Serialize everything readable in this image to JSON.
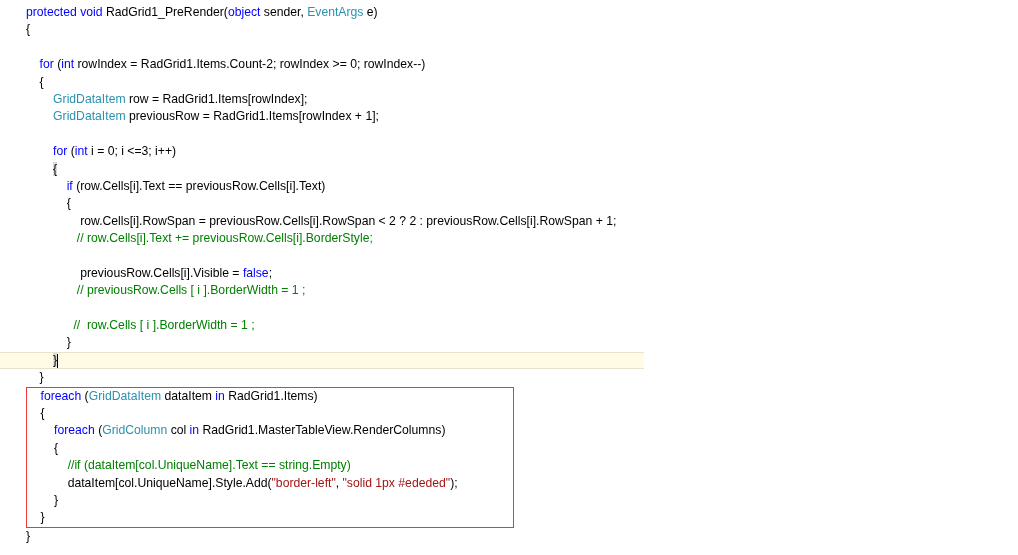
{
  "editor": {
    "sections": [
      {
        "boxed": false,
        "lines": [
          {
            "kind": "code",
            "current": false,
            "tokens": [
              {
                "kind": "keyword",
                "text": "protected void "
              },
              {
                "kind": "plain",
                "text": "RadGrid1_PreRender("
              },
              {
                "kind": "keyword",
                "text": "object"
              },
              {
                "kind": "plain",
                "text": " sender, "
              },
              {
                "kind": "type",
                "text": "EventArgs"
              },
              {
                "kind": "plain",
                "text": " e)"
              }
            ]
          },
          {
            "kind": "code",
            "current": false,
            "tokens": [
              {
                "kind": "plain",
                "text": "{"
              }
            ]
          },
          {
            "kind": "blank",
            "current": false
          },
          {
            "kind": "code",
            "current": false,
            "tokens": [
              {
                "kind": "keyword",
                "text": "    for"
              },
              {
                "kind": "plain",
                "text": " ("
              },
              {
                "kind": "keyword",
                "text": "int"
              },
              {
                "kind": "plain",
                "text": " rowIndex = RadGrid1.Items.Count-2; rowIndex >= 0; rowIndex--)"
              }
            ]
          },
          {
            "kind": "code",
            "current": false,
            "tokens": [
              {
                "kind": "plain",
                "text": "    {"
              }
            ]
          },
          {
            "kind": "code",
            "current": false,
            "tokens": [
              {
                "kind": "type",
                "text": "        GridDataItem"
              },
              {
                "kind": "plain",
                "text": " row = RadGrid1.Items[rowIndex];"
              }
            ]
          },
          {
            "kind": "code",
            "current": false,
            "tokens": [
              {
                "kind": "type",
                "text": "        GridDataItem"
              },
              {
                "kind": "plain",
                "text": " previousRow = RadGrid1.Items[rowIndex + 1];"
              }
            ]
          },
          {
            "kind": "blank",
            "current": false
          },
          {
            "kind": "code",
            "current": false,
            "tokens": [
              {
                "kind": "keyword",
                "text": "        for"
              },
              {
                "kind": "plain",
                "text": " ("
              },
              {
                "kind": "keyword",
                "text": "int"
              },
              {
                "kind": "plain",
                "text": " i = 0; i <=3; i++)"
              }
            ]
          },
          {
            "kind": "code",
            "current": false,
            "tokens": [
              {
                "kind": "plain",
                "text": "        {",
                "match": true
              }
            ]
          },
          {
            "kind": "code",
            "current": false,
            "tokens": [
              {
                "kind": "keyword",
                "text": "            if"
              },
              {
                "kind": "plain",
                "text": " (row.Cells[i].Text == previousRow.Cells[i].Text)"
              }
            ]
          },
          {
            "kind": "code",
            "current": false,
            "tokens": [
              {
                "kind": "plain",
                "text": "            {"
              }
            ]
          },
          {
            "kind": "code",
            "current": false,
            "tokens": [
              {
                "kind": "plain",
                "text": "                row.Cells[i].RowSpan = previousRow.Cells[i].RowSpan < 2 ? 2 : previousRow.Cells[i].RowSpan + 1;"
              }
            ]
          },
          {
            "kind": "code",
            "current": false,
            "tokens": [
              {
                "kind": "comment",
                "text": "               // row.Cells[i].Text += previousRow.Cells[i].BorderStyle;"
              }
            ]
          },
          {
            "kind": "blank",
            "current": false
          },
          {
            "kind": "code",
            "current": false,
            "tokens": [
              {
                "kind": "plain",
                "text": "                previousRow.Cells[i].Visible = "
              },
              {
                "kind": "keyword",
                "text": "false"
              },
              {
                "kind": "plain",
                "text": ";"
              }
            ]
          },
          {
            "kind": "code",
            "current": false,
            "tokens": [
              {
                "kind": "comment",
                "text": "               // previousRow.Cells [ i ].BorderWidth = 1 ;"
              }
            ]
          },
          {
            "kind": "blank",
            "current": false
          },
          {
            "kind": "code",
            "current": false,
            "tokens": [
              {
                "kind": "comment",
                "text": "              //  row.Cells [ i ].BorderWidth = 1 ;"
              }
            ]
          },
          {
            "kind": "code",
            "current": false,
            "tokens": [
              {
                "kind": "plain",
                "text": "            }"
              }
            ]
          },
          {
            "kind": "code",
            "current": true,
            "tokens": [
              {
                "kind": "plain",
                "text": "        }",
                "match": true
              }
            ]
          },
          {
            "kind": "code",
            "current": false,
            "tokens": [
              {
                "kind": "plain",
                "text": "    }"
              }
            ]
          }
        ]
      },
      {
        "boxed": true,
        "lines": [
          {
            "kind": "code",
            "current": false,
            "tokens": [
              {
                "kind": "keyword",
                "text": "    foreach"
              },
              {
                "kind": "plain",
                "text": " ("
              },
              {
                "kind": "type",
                "text": "GridDataItem"
              },
              {
                "kind": "plain",
                "text": " dataItem "
              },
              {
                "kind": "keyword",
                "text": "in"
              },
              {
                "kind": "plain",
                "text": " RadGrid1.Items)"
              }
            ]
          },
          {
            "kind": "code",
            "current": false,
            "tokens": [
              {
                "kind": "plain",
                "text": "    {"
              }
            ]
          },
          {
            "kind": "code",
            "current": false,
            "tokens": [
              {
                "kind": "keyword",
                "text": "        foreach"
              },
              {
                "kind": "plain",
                "text": " ("
              },
              {
                "kind": "type",
                "text": "GridColumn"
              },
              {
                "kind": "plain",
                "text": " col "
              },
              {
                "kind": "keyword",
                "text": "in"
              },
              {
                "kind": "plain",
                "text": " RadGrid1.MasterTableView.RenderColumns)"
              }
            ]
          },
          {
            "kind": "code",
            "current": false,
            "tokens": [
              {
                "kind": "plain",
                "text": "        {"
              }
            ]
          },
          {
            "kind": "code",
            "current": false,
            "tokens": [
              {
                "kind": "comment",
                "text": "            //if (dataItem[col.UniqueName].Text == string.Empty)"
              }
            ]
          },
          {
            "kind": "code",
            "current": false,
            "tokens": [
              {
                "kind": "plain",
                "text": "            dataItem[col.UniqueName].Style.Add("
              },
              {
                "kind": "string",
                "text": "\"border-left\""
              },
              {
                "kind": "plain",
                "text": ", "
              },
              {
                "kind": "string",
                "text": "\"solid 1px #ededed\""
              },
              {
                "kind": "plain",
                "text": ");"
              }
            ]
          },
          {
            "kind": "code",
            "current": false,
            "tokens": [
              {
                "kind": "plain",
                "text": "        }"
              }
            ]
          },
          {
            "kind": "code",
            "current": false,
            "tokens": [
              {
                "kind": "plain",
                "text": "    }"
              }
            ]
          }
        ]
      },
      {
        "boxed": false,
        "lines": [
          {
            "kind": "code",
            "current": false,
            "tokens": [
              {
                "kind": "plain",
                "text": "}"
              }
            ]
          }
        ]
      }
    ]
  }
}
